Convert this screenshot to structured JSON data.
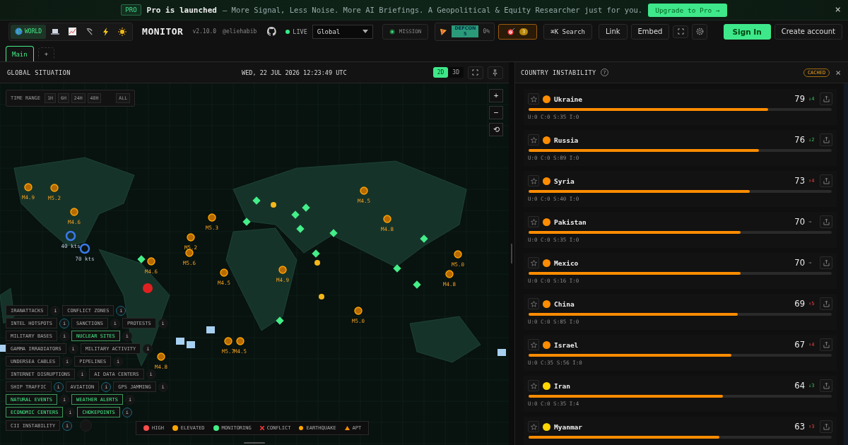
{
  "banner": {
    "badge": "PRO",
    "headline": "Pro is launched",
    "text": "– More Signal, Less Noise. More AI Briefings. A Geopolitical & Equity Researcher just for you.",
    "cta": "Upgrade to Pro →",
    "close": "×"
  },
  "header": {
    "variants": [
      {
        "kind": "globe",
        "label": "WORLD",
        "selected": true
      },
      {
        "kind": "laptop",
        "selected": false
      },
      {
        "kind": "chart",
        "selected": false
      },
      {
        "kind": "pick",
        "selected": false
      },
      {
        "kind": "bolt",
        "selected": false
      },
      {
        "kind": "sun",
        "selected": false
      }
    ],
    "brand": "MONITOR",
    "version": "v2.10.0",
    "author": "@eliehabib",
    "live": "LIVE",
    "region": "Global",
    "mission": "MISSION",
    "defcon": "DEFCON\n5",
    "defcon_pct": "0%",
    "alerts": "3",
    "search_key": "⌘K",
    "search": "Search",
    "link": "Link",
    "embed": "Embed",
    "sign_in": "Sign In",
    "create": "Create account"
  },
  "tabs": [
    {
      "label": "Main",
      "selected": true
    },
    {
      "label": "+",
      "selected": false
    }
  ],
  "map_panel": {
    "title": "GLOBAL SITUATION",
    "datetime": "WED, 22 JUL 2026 12:23:49 UTC",
    "views": [
      {
        "label": "2D",
        "selected": true
      },
      {
        "label": "3D",
        "selected": false
      }
    ],
    "time_range": {
      "label": "TIME RANGE",
      "options": [
        {
          "label": "1H",
          "selected": false
        },
        {
          "label": "6H",
          "selected": false
        },
        {
          "label": "24H",
          "selected": false
        },
        {
          "label": "48H",
          "selected": false
        },
        {
          "label": "ALL",
          "selected": false
        }
      ]
    },
    "zoom": [
      "+",
      "−",
      "⟲"
    ],
    "markers": [
      {
        "kind": "quake",
        "label": "M4.9"
      },
      {
        "kind": "quake",
        "label": "M5.2"
      },
      {
        "kind": "quake",
        "label": "M4.6"
      },
      {
        "kind": "quake",
        "label": "M5.3"
      },
      {
        "kind": "quake",
        "label": "M5.2"
      },
      {
        "kind": "quake",
        "label": "M5.6"
      },
      {
        "kind": "quake",
        "label": "M4.5"
      },
      {
        "kind": "quake",
        "label": "M5.0"
      },
      {
        "kind": "quake",
        "label": "M4.5"
      },
      {
        "kind": "quake",
        "label": "M4.8"
      },
      {
        "kind": "quake",
        "label": "M5.0"
      },
      {
        "kind": "quake",
        "label": "M4.8"
      },
      {
        "kind": "quake",
        "label": "M4.5"
      },
      {
        "kind": "quake",
        "label": "M4.8"
      },
      {
        "kind": "quake",
        "label": "M5.7"
      },
      {
        "kind": "storm",
        "label": "40 kts"
      },
      {
        "kind": "storm",
        "label": "70 kts"
      },
      {
        "kind": "quake",
        "label": "M4.6"
      },
      {
        "kind": "quake",
        "label": "M4.9"
      }
    ],
    "layer_rows": [
      [
        {
          "label": "IRANATTACKS",
          "on": false,
          "info": "i",
          "info_on": false
        },
        {
          "label": "CONFLICT ZONES",
          "on": false,
          "info": "i",
          "info_on": true
        }
      ],
      [
        {
          "label": "INTEL HOTSPOTS",
          "on": false,
          "info": "i",
          "info_on": true
        },
        {
          "label": "SANCTIONS",
          "on": false,
          "info": "i",
          "info_on": false
        },
        {
          "label": "PROTESTS",
          "on": false,
          "info": "i",
          "info_on": false
        }
      ],
      [
        {
          "label": "MILITARY BASES",
          "on": false,
          "info": "i",
          "info_on": false
        },
        {
          "label": "NUCLEAR SITES",
          "on": true,
          "info": "i",
          "info_on": false
        }
      ],
      [
        {
          "label": "GAMMA IRRADIATORS",
          "on": false,
          "info": "i",
          "info_on": false
        },
        {
          "label": "MILITARY ACTIVITY",
          "on": false,
          "info": "i",
          "info_on": false
        }
      ],
      [
        {
          "label": "UNDERSEA CABLES",
          "on": false,
          "info": "i",
          "info_on": false
        },
        {
          "label": "PIPELINES",
          "on": false,
          "info": "i",
          "info_on": false
        }
      ],
      [
        {
          "label": "INTERNET DISRUPTIONS",
          "on": false,
          "info": "i",
          "info_on": false
        },
        {
          "label": "AI DATA CENTERS",
          "on": false,
          "info": "i",
          "info_on": false
        }
      ],
      [
        {
          "label": "SHIP TRAFFIC",
          "on": false,
          "info": "i",
          "info_on": true
        },
        {
          "label": "AVIATION",
          "on": false,
          "info": "i",
          "info_on": true
        },
        {
          "label": "GPS JAMMING",
          "on": false,
          "info": "i",
          "info_on": false
        }
      ],
      [
        {
          "label": "NATURAL EVENTS",
          "on": true,
          "info": "i",
          "info_on": false
        },
        {
          "label": "WEATHER ALERTS",
          "on": true,
          "info": "i",
          "info_on": false
        }
      ],
      [
        {
          "label": "ECONOMIC CENTERS",
          "on": true,
          "info": "i",
          "info_on": false
        },
        {
          "label": "CHOKEPOINTS",
          "on": true,
          "info": "i",
          "info_on": true
        }
      ],
      [
        {
          "label": "CII INSTABILITY",
          "on": false,
          "info": "i",
          "info_on": true
        }
      ]
    ],
    "legend": [
      {
        "kind": "dot",
        "label": "HIGH",
        "color": "#ff4d4d"
      },
      {
        "kind": "dot",
        "label": "ELEVATED",
        "color": "#ffa500"
      },
      {
        "kind": "dot",
        "label": "MONITORING",
        "color": "#44ee88"
      },
      {
        "kind": "cross",
        "label": "CONFLICT",
        "color": "#ff3b3b"
      },
      {
        "kind": "small",
        "label": "EARTHQUAKE",
        "color": "#ffa500"
      },
      {
        "kind": "triangle",
        "label": "APT",
        "color": "#ff8c00"
      }
    ]
  },
  "instability_panel": {
    "title": "COUNTRY INSTABILITY",
    "help": "?",
    "status": "CACHED",
    "close": "×",
    "countries": [
      {
        "name": "Ukraine",
        "score": "79",
        "delta": "↓4",
        "kind": "down",
        "level": 0.79,
        "color": "#ff8c00",
        "components": "U:0 C:0 S:35 I:0"
      },
      {
        "name": "Russia",
        "score": "76",
        "delta": "↓2",
        "kind": "down",
        "level": 0.76,
        "color": "#ff8c00",
        "components": "U:0 C:0 S:89 I:0"
      },
      {
        "name": "Syria",
        "score": "73",
        "delta": "↑4",
        "kind": "up",
        "level": 0.73,
        "color": "#ff8c00",
        "components": "U:0 C:0 S:40 I:0"
      },
      {
        "name": "Pakistan",
        "score": "70",
        "delta": "→",
        "kind": "flat",
        "level": 0.7,
        "color": "#ff8c00",
        "components": "U:0 C:0 S:35 I:0"
      },
      {
        "name": "Mexico",
        "score": "70",
        "delta": "→",
        "kind": "flat",
        "level": 0.7,
        "color": "#ff8c00",
        "components": "U:0 C:0 S:16 I:0"
      },
      {
        "name": "China",
        "score": "69",
        "delta": "↑5",
        "kind": "up",
        "level": 0.69,
        "color": "#ff8c00",
        "components": "U:0 C:0 S:85 I:0"
      },
      {
        "name": "Israel",
        "score": "67",
        "delta": "↑4",
        "kind": "up",
        "level": 0.67,
        "color": "#ff8c00",
        "components": "U:0 C:35 S:56 I:0"
      },
      {
        "name": "Iran",
        "score": "64",
        "delta": "↓3",
        "kind": "down",
        "level": 0.64,
        "color": "#ffd500",
        "components": "U:0 C:0 S:35 I:4"
      },
      {
        "name": "Myanmar",
        "score": "63",
        "delta": "↑3",
        "kind": "up",
        "level": 0.63,
        "color": "#ffd500"
      }
    ]
  }
}
